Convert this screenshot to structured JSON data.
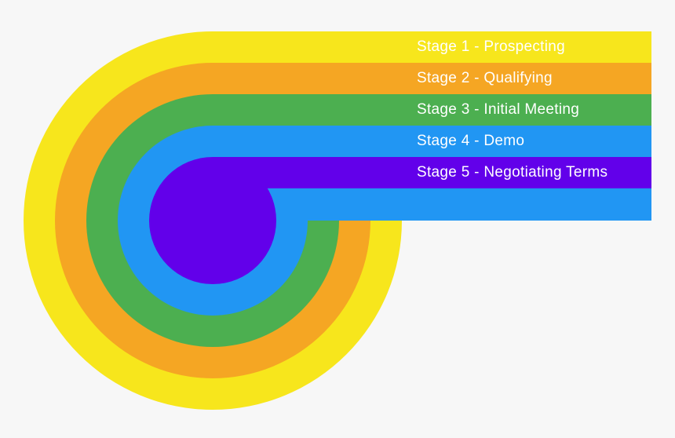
{
  "diagram": {
    "stages": [
      {
        "label": "Stage 1 - Prospecting",
        "color": "#f7e61c"
      },
      {
        "label": "Stage 2 - Qualifying",
        "color": "#f5a623"
      },
      {
        "label": "Stage 3 - Initial Meeting",
        "color": "#4caf50"
      },
      {
        "label": "Stage 4 - Demo",
        "color": "#2196f3"
      },
      {
        "label": "Stage 5 - Negotiating Terms",
        "color": "#6200ea"
      }
    ]
  }
}
